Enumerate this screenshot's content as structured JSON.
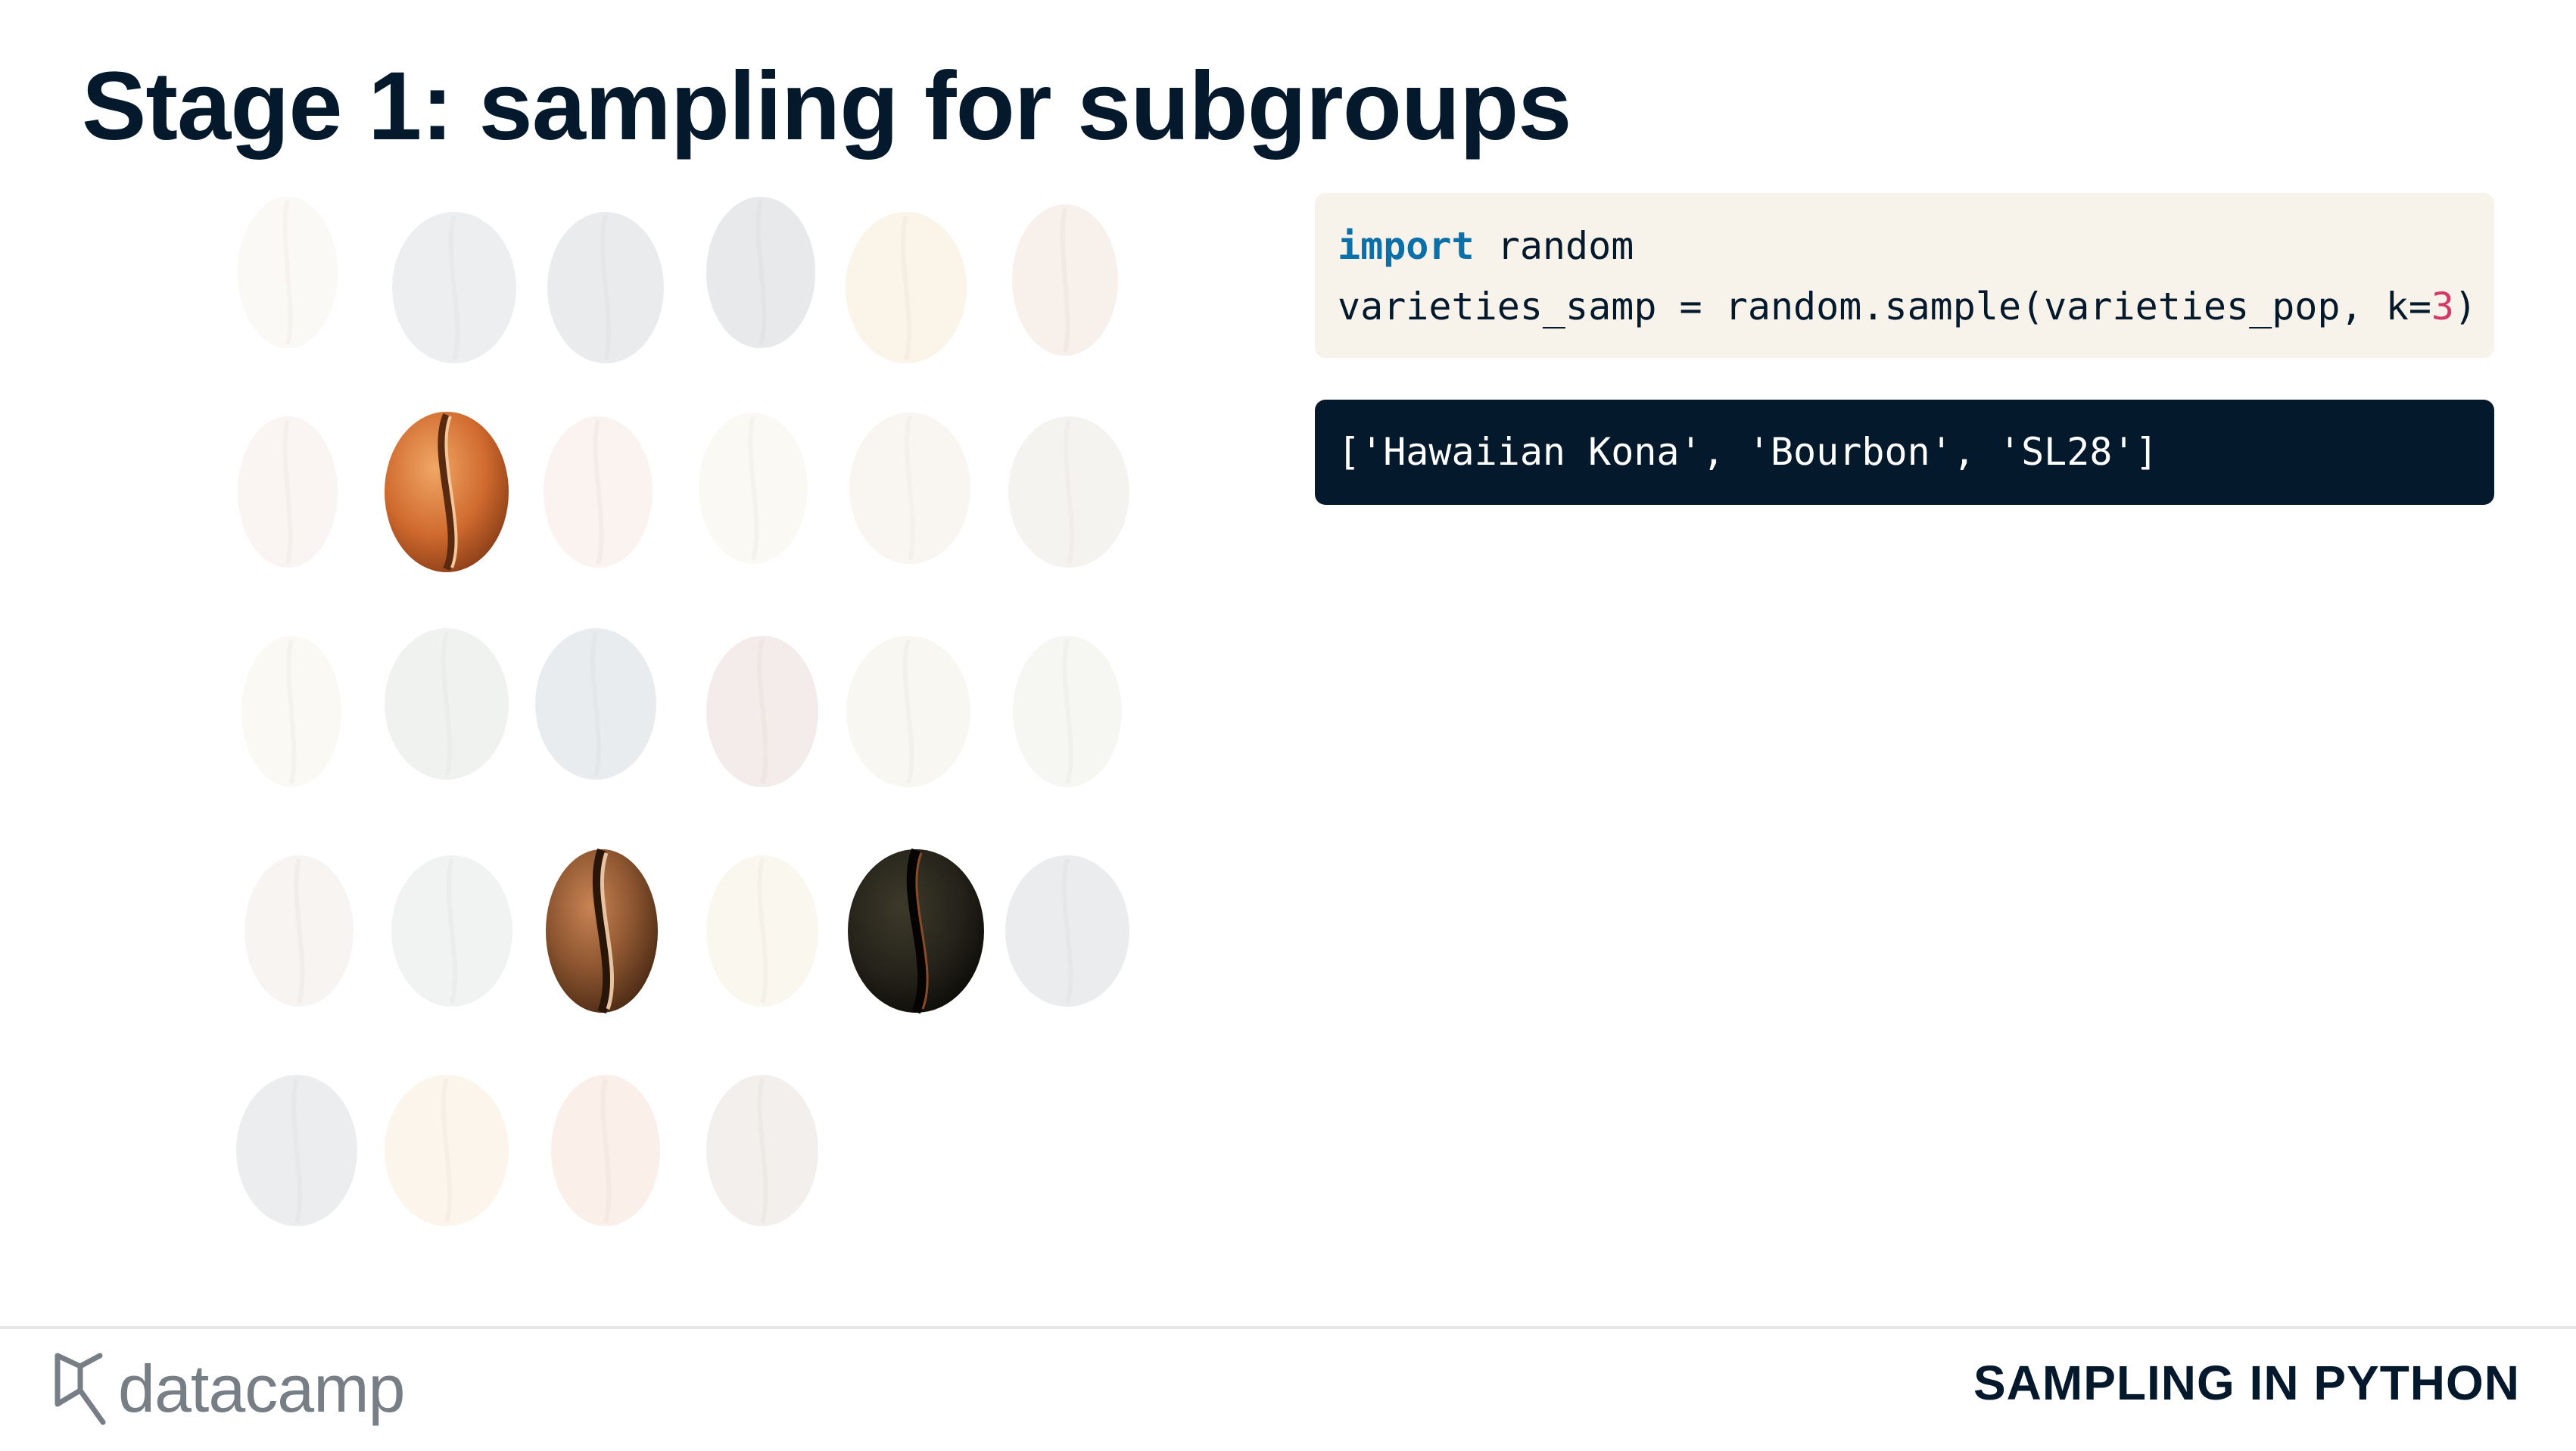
{
  "slide": {
    "title": "Stage 1: sampling for subgroups"
  },
  "code": {
    "line1_keyword": "import",
    "line1_rest": " random",
    "line2_prefix": "varieties_samp = random.sample(varieties_pop, k=",
    "line2_number": "3",
    "line2_suffix": ")"
  },
  "output": {
    "text": "['Hawaiian Kona', 'Bourbon', 'SL28']"
  },
  "beans": {
    "total": 28,
    "highlighted_count": 3,
    "icon": "coffee-bean-icon"
  },
  "footer": {
    "logo_text": "datacamp",
    "course_name": "SAMPLING IN PYTHON"
  },
  "colors": {
    "title": "#05192d",
    "code_background": "#f7f3eb",
    "keyword": "#0b6fa8",
    "number": "#d63865",
    "output_background": "#05192d",
    "logo": "#777e85"
  }
}
